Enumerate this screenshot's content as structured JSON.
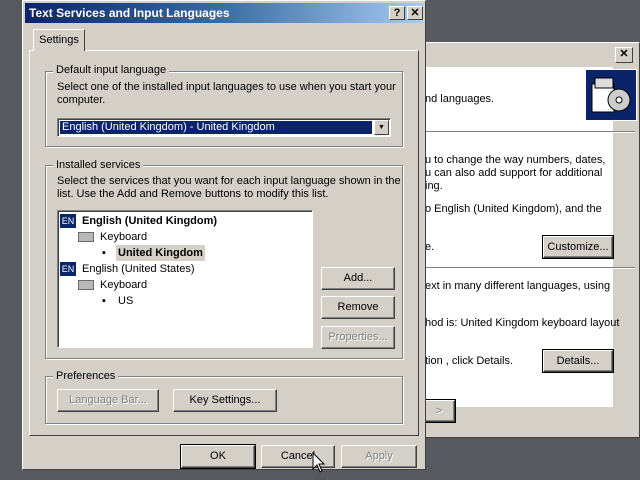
{
  "background_window": {
    "close_label": "✕",
    "text_languages": "nd languages.",
    "text_p1_l1": "u to change the way numbers, dates,",
    "text_p1_l2": "u can also add support for additional",
    "text_p1_l3": "ing.",
    "text_p2": "o English (United Kingdom), and the",
    "text_p3": "e.",
    "customize_label": "Customize...",
    "text_p4_l1": "ext in many different languages, using",
    "text_p5": "hod is: United Kingdom keyboard layout",
    "text_p6": "tion , click Details.",
    "details_label": "Details...",
    "back_label": "> "
  },
  "dialog": {
    "title": "Text Services and Input Languages",
    "help_label": "?",
    "close_label": "✕",
    "tab_settings": "Settings",
    "default_group": {
      "legend": "Default input language",
      "description": "Select one of the installed input languages to use when you start your computer.",
      "selected_value": "English (United Kingdom) - United Kingdom"
    },
    "installed_group": {
      "legend": "Installed services",
      "description": "Select the services that you want for each input language shown in the list. Use the Add and Remove buttons to modify this list.",
      "tree": [
        {
          "badge": "EN",
          "label": "English (United Kingdom)"
        },
        {
          "label": "Keyboard"
        },
        {
          "label": "United Kingdom"
        },
        {
          "badge": "EN",
          "label": "English (United States)"
        },
        {
          "label": "Keyboard"
        },
        {
          "label": "US"
        }
      ],
      "add_label": "Add...",
      "remove_label": "Remove",
      "properties_label": "Properties..."
    },
    "preferences_group": {
      "legend": "Preferences",
      "language_bar_label": "Language Bar...",
      "key_settings_label": "Key Settings..."
    },
    "ok_label": "OK",
    "cancel_label": "Cancel",
    "apply_label": "Apply"
  }
}
